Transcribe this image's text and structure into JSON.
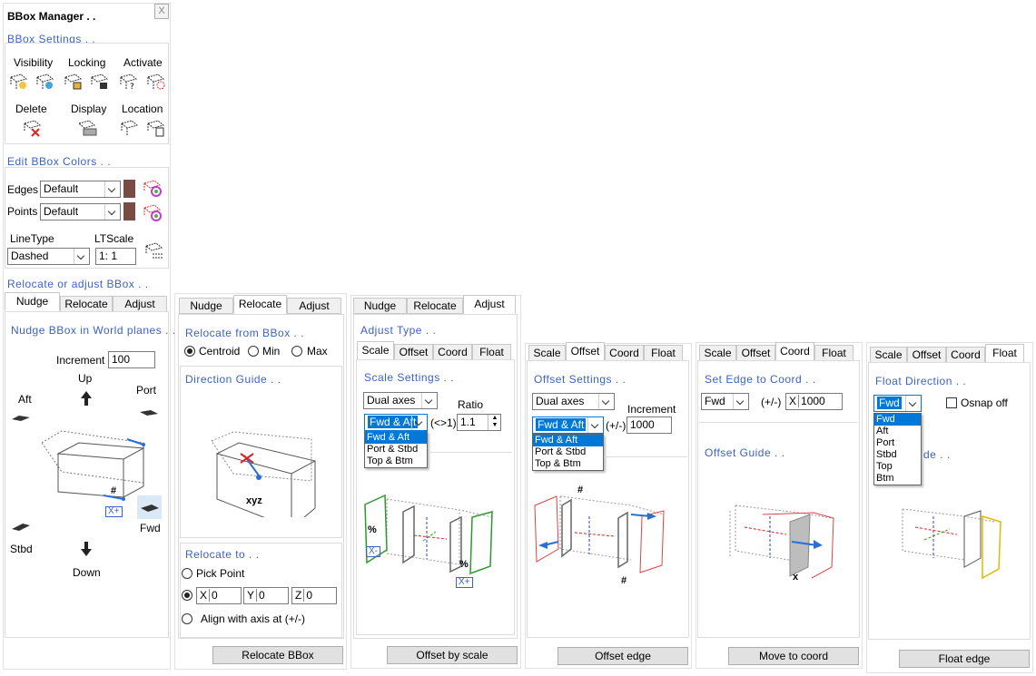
{
  "colors": {
    "accent": "#3b62c4",
    "swatch": "#7a4a44",
    "select": "#0078d7"
  },
  "p1": {
    "title": "BBox Manager . .",
    "close": "X",
    "settings_head": "BBox Settings . .",
    "visibility": "Visibility",
    "locking": "Locking",
    "activate": "Activate",
    "delete": "Delete",
    "display": "Display",
    "location": "Location",
    "colors_head": "Edit BBox Colors . .",
    "edges_label": "Edges",
    "edges_value": "Default",
    "points_label": "Points",
    "points_value": "Default",
    "linetype_label": "LineType",
    "linetype_value": "Dashed",
    "ltscale_label": "LTScale",
    "ltscale_prefix": "1:",
    "ltscale_value": "1",
    "relocate_head": "Relocate or adjust BBox . .",
    "tabs": [
      "Nudge",
      "Relocate",
      "Adjust"
    ],
    "nudge_head": "Nudge BBox in World planes . .",
    "increment_label": "Increment",
    "increment_value": "100",
    "up": "Up",
    "aft": "Aft",
    "port": "Port",
    "stbd": "Stbd",
    "fwd": "Fwd",
    "down": "Down",
    "hash": "#",
    "xplus": "X+"
  },
  "p2": {
    "tabs": [
      "Nudge",
      "Relocate",
      "Adjust"
    ],
    "from_head": "Relocate from BBox . .",
    "centroid": "Centroid",
    "min": "Min",
    "max": "Max",
    "guide_head": "Direction Guide . .",
    "xyz": "xyz",
    "to_head": "Relocate to . .",
    "pick_point": "Pick Point",
    "x": "X",
    "x_val": "0",
    "y": "Y",
    "y_val": "0",
    "z": "Z",
    "z_val": "0",
    "align": "Align with axis at (+/-)",
    "button": "Relocate BBox"
  },
  "p3": {
    "tabs": [
      "Nudge",
      "Relocate",
      "Adjust"
    ],
    "type_head": "Adjust Type . .",
    "subtabs": [
      "Scale",
      "Offset",
      "Coord",
      "Float"
    ],
    "settings_head": "Scale Settings . .",
    "mode": "Dual axes",
    "dir": "Fwd & Aft",
    "ratio_label": "Ratio",
    "ratio_prefix": "(<>1)",
    "ratio_value": "1.1",
    "options": [
      "Fwd & Aft",
      "Port & Stbd",
      "Top & Btm"
    ],
    "pct": "%",
    "xminus": "X-",
    "xplus": "X+",
    "button": "Offset by scale"
  },
  "p4": {
    "subtabs": [
      "Scale",
      "Offset",
      "Coord",
      "Float"
    ],
    "settings_head": "Offset Settings . .",
    "mode": "Dual axes",
    "increment_label": "Increment",
    "prefix": "(+/-)",
    "increment_value": "1000",
    "dir": "Fwd & Aft",
    "options": [
      "Fwd & Aft",
      "Port & Stbd",
      "Top & Btm"
    ],
    "hash": "#",
    "button": "Offset edge"
  },
  "p5": {
    "subtabs": [
      "Scale",
      "Offset",
      "Coord",
      "Float"
    ],
    "head": "Set Edge to Coord . .",
    "dir": "Fwd",
    "prefix": "(+/-)",
    "x": "X",
    "value": "1000",
    "guide_head": "Offset Guide . .",
    "xlabel": "x",
    "button": "Move to coord"
  },
  "p6": {
    "subtabs": [
      "Scale",
      "Offset",
      "Coord",
      "Float"
    ],
    "head": "Float Direction . .",
    "dir": "Fwd",
    "osnap": "Osnap off",
    "options": [
      "Fwd",
      "Aft",
      "Port",
      "Stbd",
      "Top",
      "Btm"
    ],
    "guide_tail": "de . .",
    "button": "Float edge"
  }
}
